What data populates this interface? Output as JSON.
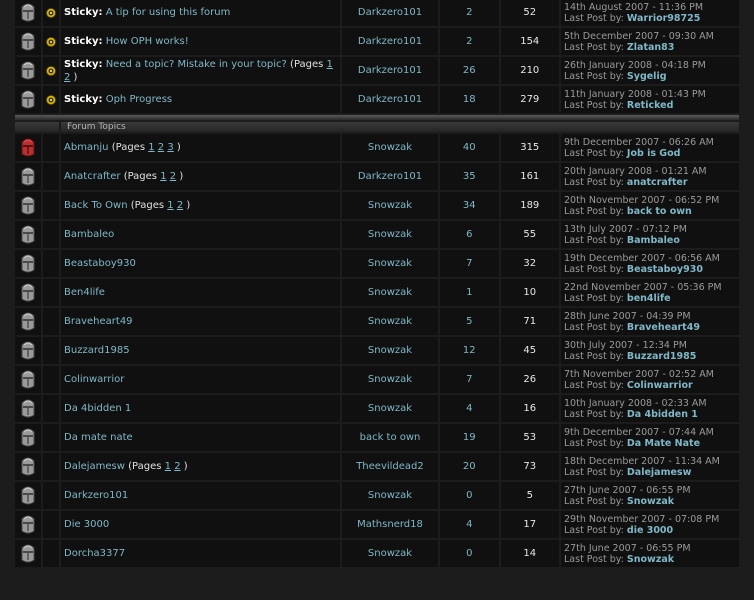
{
  "colors": {
    "accent": "#7fb8c8",
    "background": "#1c1c1c",
    "cell": "#101010"
  },
  "sticky_label": "Sticky:",
  "pages_label": "Pages",
  "last_post_label": "Last Post by:",
  "section_title": "Forum Topics",
  "stickies": [
    {
      "title": "A tip for using this forum",
      "author": "Darkzero101",
      "replies": "2",
      "views": "52",
      "date": "14th August 2007 - 11:36 PM",
      "last_by": "Warrior98725"
    },
    {
      "title": "How OPH works!",
      "author": "Darkzero101",
      "replies": "2",
      "views": "154",
      "date": "5th December 2007 - 09:30 AM",
      "last_by": "Zlatan83"
    },
    {
      "title": "Need a topic? Mistake in your topic?",
      "pages": [
        "1",
        "2"
      ],
      "author": "Darkzero101",
      "replies": "26",
      "views": "210",
      "date": "26th January 2008 - 04:18 PM",
      "last_by": "Sygelig"
    },
    {
      "title": "Oph Progress",
      "author": "Darkzero101",
      "replies": "18",
      "views": "279",
      "date": "11th January 2008 - 01:43 PM",
      "last_by": "Reticked"
    }
  ],
  "topics": [
    {
      "title": "Abmanju",
      "hot": true,
      "pages": [
        "1",
        "2",
        "3"
      ],
      "author": "Snowzak",
      "replies": "40",
      "views": "315",
      "date": "9th December 2007 - 06:26 AM",
      "last_by": "Job is God"
    },
    {
      "title": "Anatcrafter",
      "pages": [
        "1",
        "2"
      ],
      "author": "Darkzero101",
      "replies": "35",
      "views": "161",
      "date": "20th January 2008 - 01:21 AM",
      "last_by": "anatcrafter"
    },
    {
      "title": "Back To Own",
      "pages": [
        "1",
        "2"
      ],
      "author": "Snowzak",
      "replies": "34",
      "views": "189",
      "date": "20th November 2007 - 06:52 PM",
      "last_by": "back to own"
    },
    {
      "title": "Bambaleo",
      "author": "Snowzak",
      "replies": "6",
      "views": "55",
      "date": "13th July 2007 - 07:12 PM",
      "last_by": "Bambaleo"
    },
    {
      "title": "Beastaboy930",
      "author": "Snowzak",
      "replies": "7",
      "views": "32",
      "date": "19th December 2007 - 06:56 AM",
      "last_by": "Beastaboy930"
    },
    {
      "title": "Ben4life",
      "author": "Snowzak",
      "replies": "1",
      "views": "10",
      "date": "22nd November 2007 - 05:36 PM",
      "last_by": "ben4life"
    },
    {
      "title": "Braveheart49",
      "author": "Snowzak",
      "replies": "5",
      "views": "71",
      "date": "28th June 2007 - 04:39 PM",
      "last_by": "Braveheart49"
    },
    {
      "title": "Buzzard1985",
      "author": "Snowzak",
      "replies": "12",
      "views": "45",
      "date": "30th July 2007 - 12:34 PM",
      "last_by": "Buzzard1985"
    },
    {
      "title": "Colinwarrior",
      "author": "Snowzak",
      "replies": "7",
      "views": "26",
      "date": "7th November 2007 - 02:52 AM",
      "last_by": "Colinwarrior"
    },
    {
      "title": "Da 4bidden 1",
      "author": "Snowzak",
      "replies": "4",
      "views": "16",
      "date": "10th January 2008 - 02:33 AM",
      "last_by": "Da 4bidden 1"
    },
    {
      "title": "Da mate nate",
      "author": "back to own",
      "replies": "19",
      "views": "53",
      "date": "9th December 2007 - 07:44 AM",
      "last_by": "Da Mate Nate"
    },
    {
      "title": "Dalejamesw",
      "pages": [
        "1",
        "2"
      ],
      "author": "Theevildead2",
      "replies": "20",
      "views": "73",
      "date": "18th December 2007 - 11:34 AM",
      "last_by": "Dalejamesw"
    },
    {
      "title": "Darkzero101",
      "author": "Snowzak",
      "replies": "0",
      "views": "5",
      "date": "27th June 2007 - 06:55 PM",
      "last_by": "Snowzak"
    },
    {
      "title": "Die 3000",
      "author": "Mathsnerd18",
      "replies": "4",
      "views": "17",
      "date": "29th November 2007 - 07:08 PM",
      "last_by": "die 3000"
    },
    {
      "title": "Dorcha3377",
      "author": "Snowzak",
      "replies": "0",
      "views": "14",
      "date": "27th June 2007 - 06:55 PM",
      "last_by": "Snowzak"
    }
  ]
}
